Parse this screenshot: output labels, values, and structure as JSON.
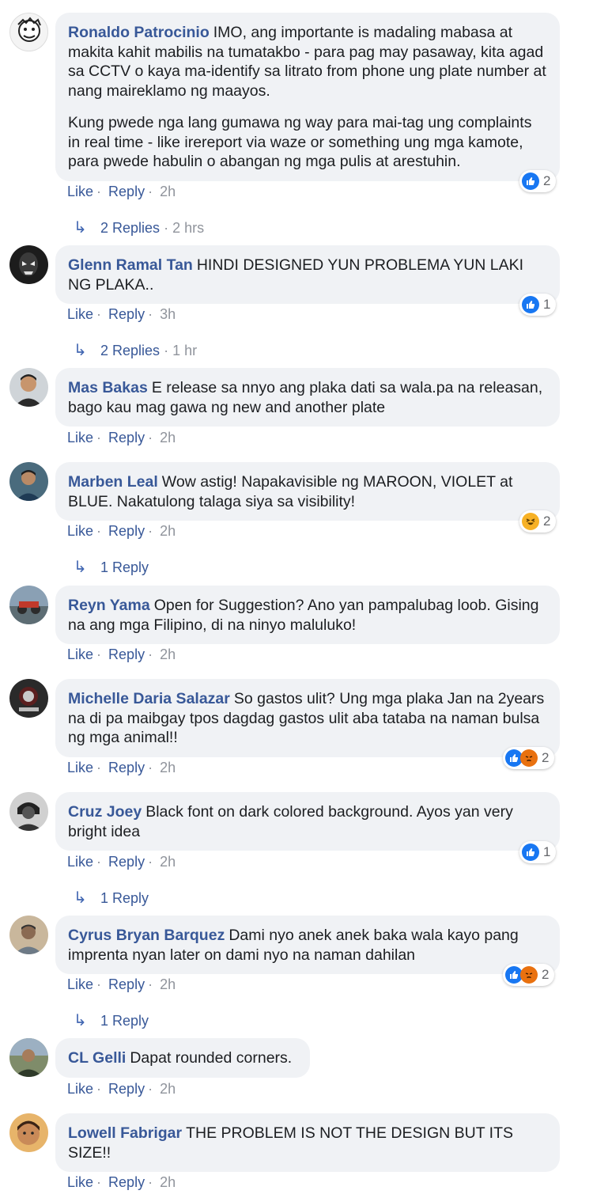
{
  "labels": {
    "like": "Like",
    "reply": "Reply",
    "dot": "·"
  },
  "colors": {
    "link": "#385898",
    "meta": "#90949c",
    "bubble": "#f0f2f5",
    "like_reaction": "#1877f2",
    "angry_reaction": "#e9710f",
    "haha_reaction": "#f7b125"
  },
  "comments": [
    {
      "author": "Ronaldo Patrocinio",
      "paragraphs": [
        "IMO, ang importante is madaling mabasa at makita kahit mabilis na tumatakbo - para pag may pasaway, kita agad sa CCTV o kaya ma-identify sa litrato from phone ung plate number at nang maireklamo ng maayos.",
        "Kung pwede nga lang gumawa ng way para mai-tag ung complaints in real time - like irereport via waze or something ung mga kamote, para pwede habulin o abangan ng mga pulis at arestuhin."
      ],
      "time": "2h",
      "reactions": {
        "icons": [
          "like-icon"
        ],
        "count": "2"
      },
      "replies": {
        "label": "2 Replies",
        "time": "2 hrs"
      }
    },
    {
      "author": "Glenn Ramal Tan",
      "paragraphs": [
        "HINDI DESIGNED YUN PROBLEMA YUN LAKI NG PLAKA.."
      ],
      "time": "3h",
      "reactions": {
        "icons": [
          "like-icon"
        ],
        "count": "1"
      },
      "replies": {
        "label": "2 Replies",
        "time": "1 hr"
      }
    },
    {
      "author": "Mas Bakas",
      "paragraphs": [
        "E release sa nnyo ang plaka dati sa wala.pa na releasan, bago kau mag gawa ng new and another plate"
      ],
      "time": "2h"
    },
    {
      "author": "Marben Leal",
      "paragraphs": [
        "Wow astig! Napakavisible ng MAROON, VIOLET at BLUE. Nakatulong talaga siya sa visibility!"
      ],
      "time": "2h",
      "reactions": {
        "icons": [
          "haha-icon"
        ],
        "count": "2"
      },
      "replies": {
        "label": "1 Reply",
        "time": ""
      }
    },
    {
      "author": "Reyn Yama",
      "paragraphs": [
        "Open for Suggestion? Ano yan pampalubag loob. Gising na ang mga Filipino, di na ninyo maluluko!"
      ],
      "time": "2h"
    },
    {
      "author": "Michelle Daria Salazar",
      "paragraphs": [
        "So gastos ulit? Ung mga plaka Jan na 2years na di pa maibgay tpos dagdag gastos ulit aba tataba na naman bulsa ng mga animal!!"
      ],
      "time": "2h",
      "reactions": {
        "icons": [
          "like-icon",
          "angry-icon"
        ],
        "count": "2"
      }
    },
    {
      "author": "Cruz Joey",
      "paragraphs": [
        "Black font on dark colored background. Ayos yan very bright idea"
      ],
      "time": "2h",
      "reactions": {
        "icons": [
          "like-icon"
        ],
        "count": "1"
      },
      "replies": {
        "label": "1 Reply",
        "time": ""
      }
    },
    {
      "author": "Cyrus Bryan Barquez",
      "paragraphs": [
        "Dami nyo anek anek baka wala kayo pang imprenta nyan later on dami nyo na naman dahilan"
      ],
      "time": "2h",
      "reactions": {
        "icons": [
          "like-icon",
          "angry-icon"
        ],
        "count": "2"
      },
      "replies": {
        "label": "1 Reply",
        "time": ""
      }
    },
    {
      "author": "CL Gelli",
      "paragraphs": [
        "Dapat rounded corners."
      ],
      "time": "2h"
    },
    {
      "author": "Lowell Fabrigar",
      "paragraphs": [
        "THE PROBLEM IS NOT THE DESIGN BUT ITS SIZE!!"
      ],
      "time": "2h"
    }
  ]
}
